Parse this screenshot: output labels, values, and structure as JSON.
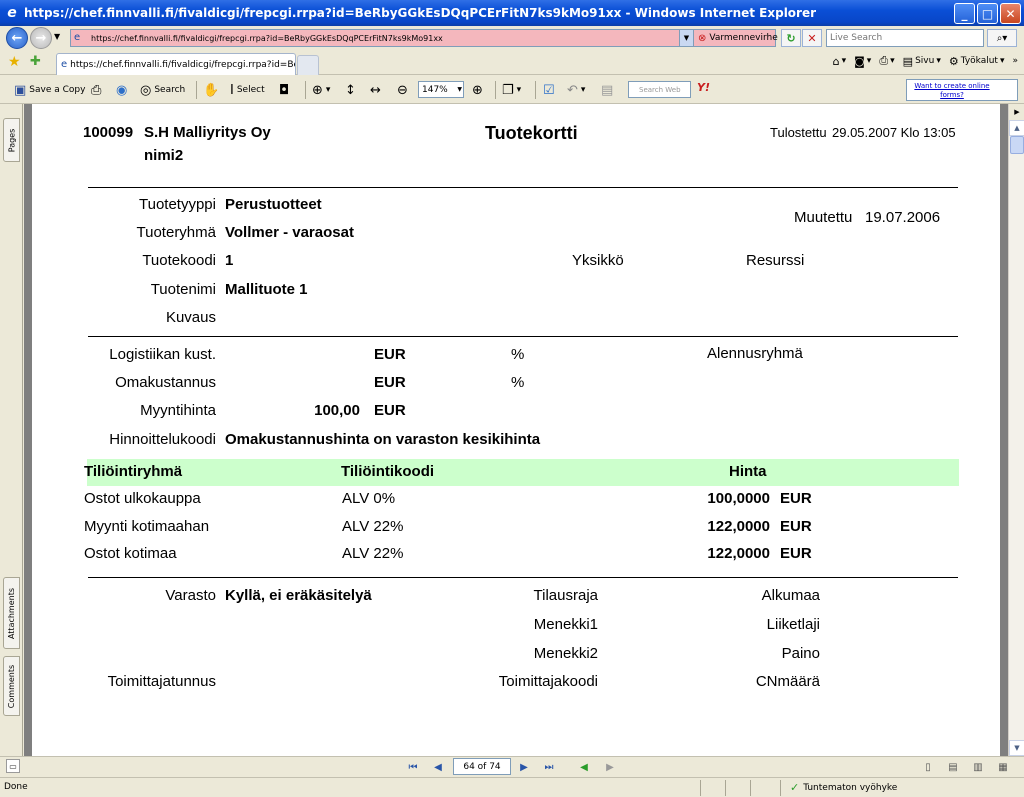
{
  "window": {
    "title": "https://chef.finnvalli.fi/fivaldicgi/frepcgi.rrpa?id=BeRbyGGkEsDQqPCErFitN7ks9kMo91xx - Windows Internet Explorer"
  },
  "address": {
    "url": "https://chef.finnvalli.fi/fivaldicgi/frepcgi.rrpa?id=BeRbyGGkEsDQqPCErFitN7ks9kMo91xx",
    "cert_error": "Varmennevirhe",
    "search_placeholder": "Live Search"
  },
  "tabs": [
    {
      "label": "https://chef.finnvalli.fi/fivaldicgi/frepcgi.rrpa?id=BeR..."
    }
  ],
  "commandbar": {
    "page_label": "Sivu",
    "tools_label": "Työkalut"
  },
  "acrobat_toolbar": {
    "save_copy": "Save a Copy",
    "search": "Search",
    "select": "Select",
    "zoom": "147%",
    "search_web_placeholder": "Search Web",
    "online_forms": "Want to create online forms?"
  },
  "side_tabs": {
    "pages": "Pages",
    "attachments": "Attachments",
    "comments": "Comments"
  },
  "document": {
    "company_code": "100099",
    "company_name": "S.H Malliyritys Oy",
    "company_name2": "nimi2",
    "title": "Tuotekortti",
    "printed_label": "Tulostettu",
    "printed_value": "29.05.2007 Klo 13:05",
    "modified_label": "Muutettu",
    "modified_value": "19.07.2006",
    "fields": {
      "tuotetyyppi_label": "Tuotetyyppi",
      "tuotetyyppi_value": "Perustuotteet",
      "tuoteryhma_label": "Tuoteryhmä",
      "tuoteryhma_value": "Vollmer - varaosat",
      "tuotekoodi_label": "Tuotekoodi",
      "tuotekoodi_value": "1",
      "yksikko_label": "Yksikkö",
      "resurssi_label": "Resurssi",
      "tuotenimi_label": "Tuotenimi",
      "tuotenimi_value": "Mallituote 1",
      "kuvaus_label": "Kuvaus"
    },
    "pricing": {
      "logistiikka_label": "Logistiikan kust.",
      "logistiikka_currency": "EUR",
      "logistiikka_pct": "%",
      "alennusryhma_label": "Alennusryhmä",
      "omakustannus_label": "Omakustannus",
      "omakustannus_currency": "EUR",
      "omakustannus_pct": "%",
      "myyntihinta_label": "Myyntihinta",
      "myyntihinta_value": "100,00",
      "myyntihinta_currency": "EUR",
      "hinnoittelukoodi_label": "Hinnoittelukoodi",
      "hinnoittelukoodi_value": "Omakustannushinta on varaston kesikihinta"
    },
    "accounting_table": {
      "headers": [
        "Tiliöintiryhmä",
        "Tiliöintikoodi",
        "Hinta"
      ],
      "rows": [
        {
          "group": "Ostot ulkokauppa",
          "code": "ALV 0%",
          "price": "100,0000",
          "currency": "EUR"
        },
        {
          "group": "Myynti kotimaahan",
          "code": "ALV 22%",
          "price": "122,0000",
          "currency": "EUR"
        },
        {
          "group": "Ostot kotimaa",
          "code": "ALV 22%",
          "price": "122,0000",
          "currency": "EUR"
        }
      ]
    },
    "stock": {
      "varasto_label": "Varasto",
      "varasto_value": "Kyllä, ei eräkäsitelyä",
      "tilausraja_label": "Tilausraja",
      "alkumaa_label": "Alkumaa",
      "menekki1_label": "Menekki1",
      "liiketlaji_label": "Liiketlaji",
      "menekki2_label": "Menekki2",
      "paino_label": "Paino",
      "toimittajatunnus_label": "Toimittajatunnus",
      "toimittajakoodi_label": "Toimittajakoodi",
      "cnmaara_label": "CNmäärä"
    }
  },
  "page_nav": {
    "page_indicator": "64 of 74"
  },
  "status": {
    "left": "Done",
    "zone": "Tuntematon vyöhyke"
  }
}
